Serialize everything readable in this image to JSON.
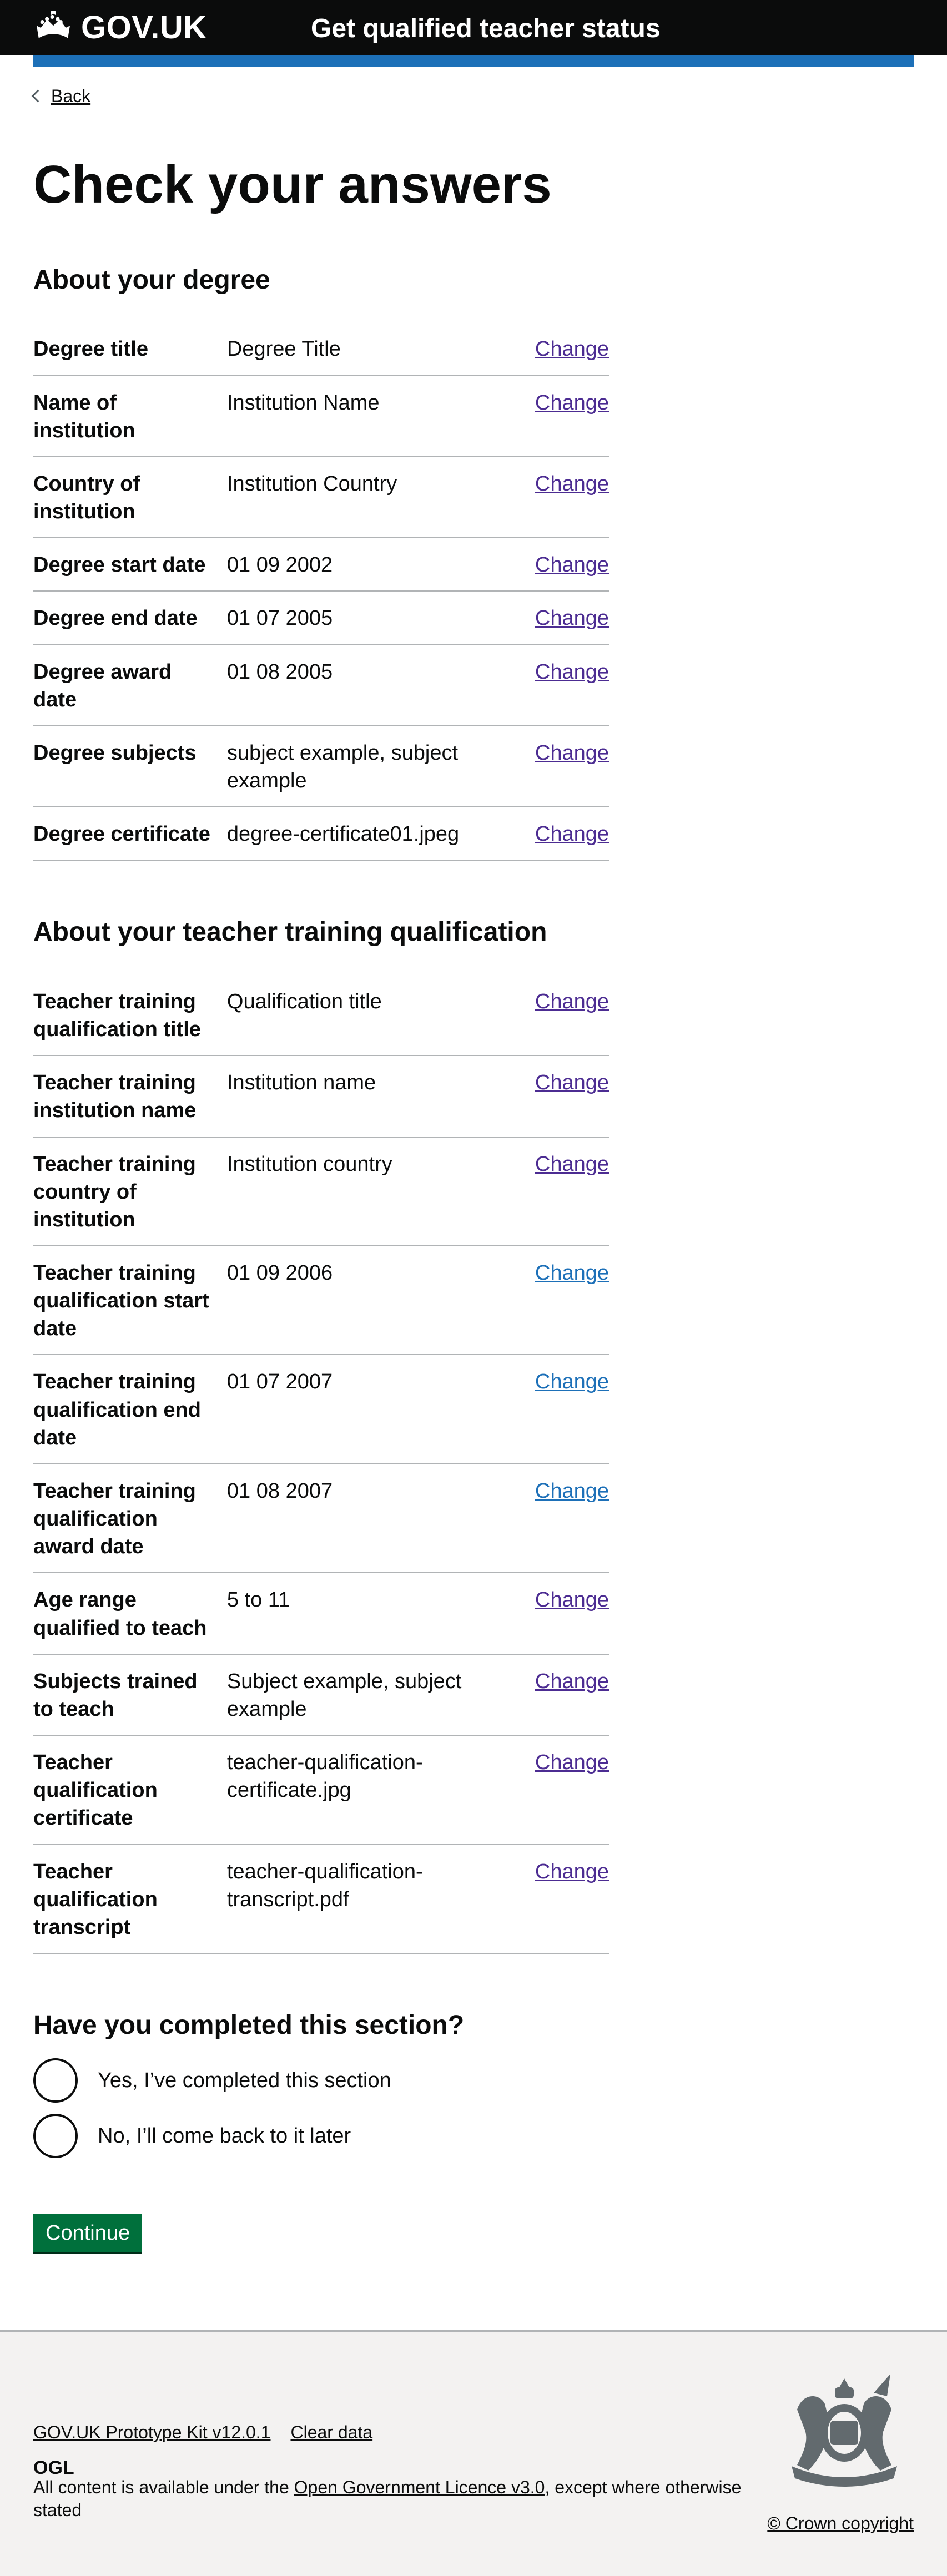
{
  "header": {
    "logo_text": "GOV.UK",
    "service_name": "Get qualified teacher status"
  },
  "back_link": "Back",
  "page_title": "Check your answers",
  "degree_section": {
    "title": "About your degree",
    "rows": [
      {
        "key": "Degree title",
        "value": "Degree Title",
        "action": "Change"
      },
      {
        "key": "Name of institution",
        "value": "Institution Name",
        "action": "Change"
      },
      {
        "key": "Country of institution",
        "value": "Institution Country",
        "action": "Change"
      },
      {
        "key": "Degree start date",
        "value": "01 09 2002",
        "action": "Change"
      },
      {
        "key": "Degree end date",
        "value": "01 07 2005",
        "action": "Change"
      },
      {
        "key": "Degree award date",
        "value": "01 08 2005",
        "action": "Change"
      },
      {
        "key": "Degree subjects",
        "value": "subject example, subject example",
        "action": "Change"
      },
      {
        "key": "Degree certificate",
        "value": "degree-certificate01.jpeg",
        "action": "Change"
      }
    ]
  },
  "training_section": {
    "title": "About your teacher training qualification",
    "rows": [
      {
        "key": "Teacher training qualification title",
        "value": "Qualification title",
        "action": "Change"
      },
      {
        "key": "Teacher training institution name",
        "value": "Institution name",
        "action": "Change"
      },
      {
        "key": "Teacher training country of institution",
        "value": "Institution country",
        "action": "Change"
      },
      {
        "key": "Teacher training qualification start date",
        "value": "01 09 2006",
        "action": "Change"
      },
      {
        "key": "Teacher training qualification end date",
        "value": "01 07 2007",
        "action": "Change"
      },
      {
        "key": "Teacher training qualification award date",
        "value": "01 08 2007",
        "action": "Change"
      },
      {
        "key": "Age range qualified to teach",
        "value": "5 to 11",
        "action": "Change"
      },
      {
        "key": "Subjects trained to teach",
        "value": "Subject example, subject example",
        "action": "Change"
      },
      {
        "key": "Teacher qualification certificate",
        "value": "teacher-qualification-certificate.jpg",
        "action": "Change"
      },
      {
        "key": "Teacher qualification transcript",
        "value": "teacher-qualification-transcript.pdf",
        "action": "Change"
      }
    ]
  },
  "completion": {
    "legend": "Have you completed this section?",
    "options": [
      {
        "label": "Yes, I’ve completed this section"
      },
      {
        "label": "No, I’ll come back to it later"
      }
    ]
  },
  "continue_label": "Continue",
  "footer": {
    "link_prototype": "GOV.UK Prototype Kit v12.0.1",
    "link_clear": "Clear data",
    "licence_prefix": "All content is available under the ",
    "licence_link": "Open Government Licence v3.0",
    "licence_suffix": ", except where otherwise stated",
    "copyright": "© Crown copyright",
    "ogl_text": "OGL"
  },
  "colors": {
    "header_bg": "#0b0c0c",
    "accent_blue": "#1d70b8",
    "visited_link": "#4c2c92",
    "button_green": "#00703c",
    "footer_bg": "#f3f2f1"
  }
}
